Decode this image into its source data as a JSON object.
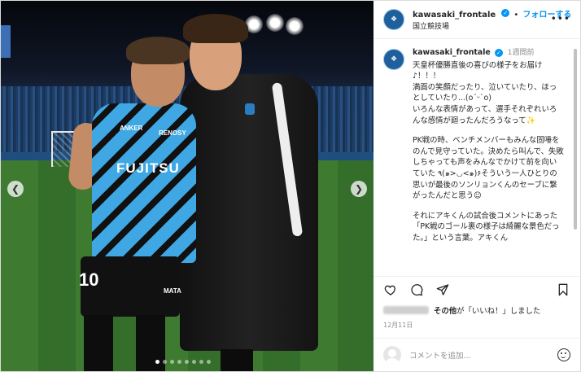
{
  "header": {
    "username": "kawasaki_frontale",
    "verified_icon": "verified-badge-icon",
    "dot": "•",
    "follow_label": "フォローする",
    "location": "国立競技場",
    "more_icon": "more-icon"
  },
  "photo": {
    "sponsor_text": "FUJITSU",
    "sponsor_top_left": "ANKER",
    "sponsor_top_right": "RENOSY",
    "shirt_number": "10",
    "brand_text": "MATA",
    "prev_icon": "chevron-left-icon",
    "next_icon": "chevron-right-icon",
    "carousel_count": 8,
    "carousel_active": 1
  },
  "caption": {
    "username": "kawasaki_frontale",
    "time": "1週間前",
    "paragraphs": [
      "天皇杯優勝直後の喜びの様子をお届け♪！！！\n満面の笑顔だったり、泣いていたり、ほっとしていたり...(o´ᵕ`o)\nいろんな表情があって、選手それぞれいろんな感情が廻ったんだろうなって✨",
      "PK戦の時、ベンチメンバーもみんな固唾をのんで見守っていた。決めたら叫んで、失敗しちゃっても声をみんなでかけて前を向いていた ٩(๑>◡<๑)۶そういう一人ひとりの思いが最後のソンリョンくんのセーブに繋がったんだと思う☺",
      "それにアキくんの試合後コメントにあった「PK戦のゴール裏の様子は綺麗な景色だった。」という言葉。アキくん"
    ]
  },
  "actions": {
    "like_icon": "heart-icon",
    "comment_icon": "comment-icon",
    "share_icon": "share-icon",
    "save_icon": "bookmark-icon"
  },
  "likes": {
    "text_bold": "その他",
    "text_rest": "が「いいね！」しました"
  },
  "date": "12月11日",
  "comment_box": {
    "placeholder": "コメントを追加...",
    "emoji_icon": "emoji-icon"
  },
  "colors": {
    "link_blue": "#0095f6",
    "muted": "#8e8e8e",
    "text": "#262626"
  }
}
